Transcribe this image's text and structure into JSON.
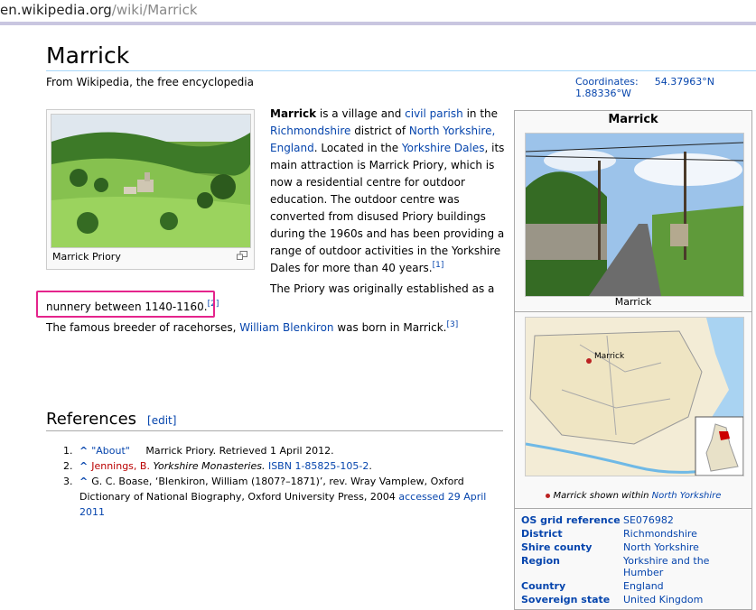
{
  "browser": {
    "url_host": "en.wikipedia.org",
    "url_path": "/wiki/Marrick"
  },
  "article": {
    "title": "Marrick",
    "tagline": "From Wikipedia, the free encyclopedia",
    "coordinates_label": "Coordinates:",
    "coordinates_value": "54.37963°N 1.88336°W",
    "thumb_caption": "Marrick Priory",
    "lead": {
      "subject": "Marrick",
      "t1": " is a village and ",
      "l1": "civil parish",
      "t2": " in the ",
      "l2": "Richmondshire",
      "t3": " district of ",
      "l3": "North Yorkshire, England",
      "t4": ". Located in the ",
      "l4": "Yorkshire Dales",
      "t5": ", its main attraction is Marrick Priory, which is now a residential centre for outdoor education. The outdoor centre was converted from disused Priory buildings during the 1960s and has been providing a range of outdoor activities in the Yorkshire Dales for more than 40 years.",
      "ref1": "[1]"
    },
    "p2_line1": "The Priory was originally established as a",
    "p2_line2": "nunnery between 1140-1160.",
    "ref2": "[2]",
    "p3_t1": "The famous breeder of racehorses, ",
    "p3_link": "William Blenkiron",
    "p3_t2": " was born in Marrick.",
    "ref3": "[3]"
  },
  "references": {
    "heading": "References",
    "edit": "[edit]",
    "items": [
      {
        "num": "1.",
        "caret": "^",
        "link": "\"About\"",
        "text": "Marrick Priory. Retrieved 1 April 2012."
      },
      {
        "num": "2.",
        "caret": "^",
        "red": "Jennings, B.",
        "italic": "Yorkshire Monasteries.",
        "isbn": "ISBN 1-85825-105-2",
        "end": "."
      },
      {
        "num": "3.",
        "caret": "^",
        "text": "G. C. Boase, ‘Blenkiron, William (1807?–1871)’, rev. Wray Vamplew, Oxford Dictionary of National Biography, Oxford University Press, 2004 ",
        "accessed": "accessed 29 April 2011"
      }
    ]
  },
  "infobox": {
    "title": "Marrick",
    "photo_caption": "Marrick",
    "map_label": "Marrick",
    "map_caption_text": "Marrick shown within ",
    "map_caption_link": "North Yorkshire",
    "rows": [
      {
        "key": "OS grid reference",
        "value": "SE076982"
      },
      {
        "key": "District",
        "value": "Richmondshire"
      },
      {
        "key": "Shire county",
        "value": "North Yorkshire"
      },
      {
        "key": "Region",
        "value": "Yorkshire and the Humber"
      },
      {
        "key": "Country",
        "value": "England"
      },
      {
        "key": "Sovereign state",
        "value": "United Kingdom"
      }
    ]
  }
}
